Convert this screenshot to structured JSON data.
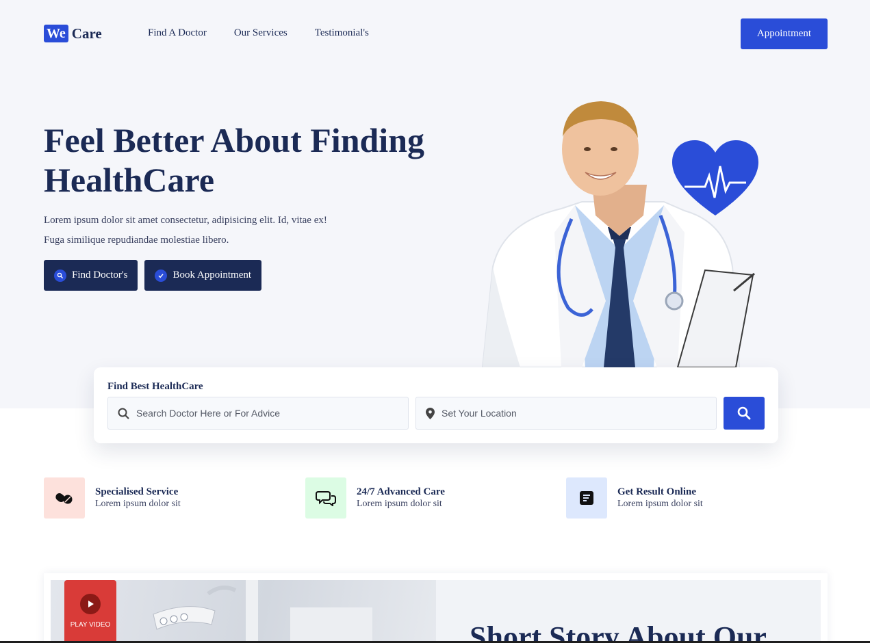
{
  "brand": {
    "logo_we": "We",
    "logo_care": "Care"
  },
  "nav": {
    "items": [
      "Find A Doctor",
      "Our Services",
      "Testimonial's"
    ],
    "cta": "Appointment"
  },
  "hero": {
    "title": "Feel Better About Finding HealthCare",
    "desc_line1": "Lorem ipsum dolor sit amet consectetur, adipisicing elit. Id, vitae ex!",
    "desc_line2": "Fuga similique repudiandae molestiae libero.",
    "btn_find": "Find Doctor's",
    "btn_book": "Book Appointment"
  },
  "search": {
    "title": "Find Best HealthCare",
    "doctor_placeholder": "Search Doctor Here or For Advice",
    "location_placeholder": "Set Your Location"
  },
  "features": [
    {
      "title": "Specialised Service",
      "sub": "Lorem ipsum dolor sit",
      "icon": "pills-icon",
      "bg": "#fde1dc"
    },
    {
      "title": "24/7 Advanced Care",
      "sub": "Lorem ipsum dolor sit",
      "icon": "chat-icon",
      "bg": "#dcfce4"
    },
    {
      "title": "Get Result Online",
      "sub": "Lorem ipsum dolor sit",
      "icon": "report-icon",
      "bg": "#dde8fd"
    }
  ],
  "story": {
    "play_label": "PLAY VIDEO",
    "title": "Short Story About Our"
  },
  "colors": {
    "primary": "#2a4dd8",
    "dark": "#1b2a55",
    "hero_bg": "#f5f6fa",
    "play": "#d93b38"
  }
}
